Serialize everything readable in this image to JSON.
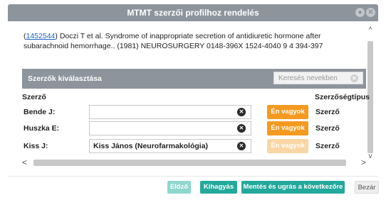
{
  "dialog": {
    "title": "MTMT szerzői profilhoz rendelés",
    "window_buttons": [
      "minimize-icon",
      "close-icon"
    ]
  },
  "citation": {
    "id": "1452544",
    "text": "Doczi T et al. Syndrome of inappropriate secretion of antidiuretic hormone after subarachnoid hemorrhage.. (1981) NEUROSURGERY 0148-396X 1524-4040 9 4 394-397",
    "prefix": "(",
    "suffix": ")"
  },
  "authors_section": {
    "title": "Szerzők kiválasztása",
    "search_placeholder": "Keresés nevekben",
    "columns": {
      "author": "Szerző",
      "author_type": "Szerzőségtípus"
    },
    "rows": [
      {
        "name": "Bende J:",
        "value": "",
        "button": "Én vagyok",
        "button_enabled": true,
        "type": "Szerző"
      },
      {
        "name": "Huszka E:",
        "value": "",
        "button": "Én vagyok",
        "button_enabled": true,
        "type": "Szerző"
      },
      {
        "name": "Kiss J:",
        "value": "Kiss János (Neurofarmakológia)",
        "button": "Én vagyok",
        "button_enabled": false,
        "type": "Szerző"
      }
    ]
  },
  "footer": {
    "prev": "Előző",
    "skip": "Kihagyás",
    "save_next": "Mentés és ugrás a következőre",
    "close": "Bezár"
  },
  "colors": {
    "header": "#8d949c",
    "accent_orange": "#f59a20",
    "accent_teal": "#23a89c",
    "link": "#1a63c8"
  }
}
